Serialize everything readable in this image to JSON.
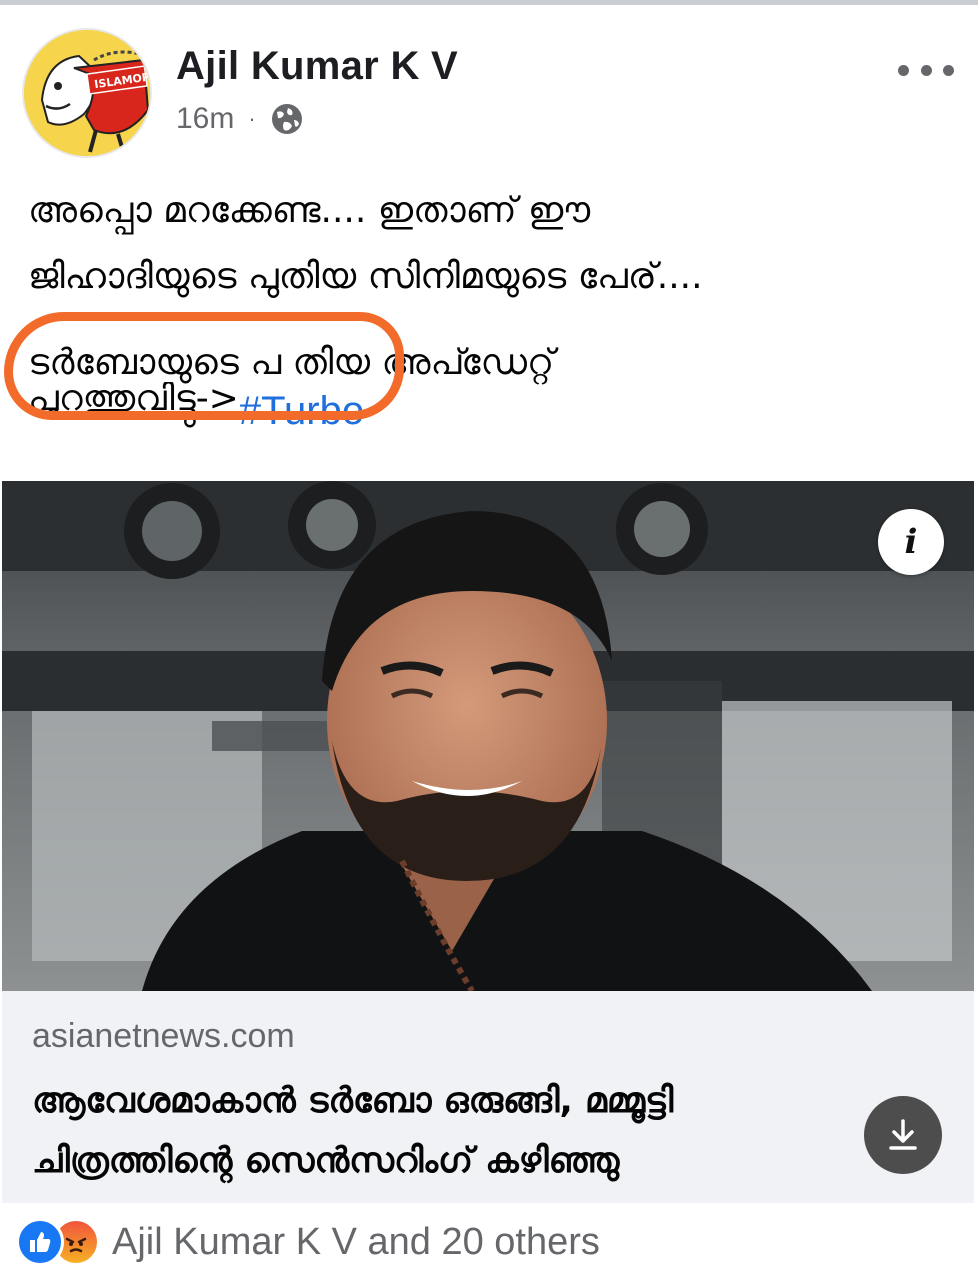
{
  "post": {
    "author": "Ajil Kumar K V",
    "avatar_text": "ISLAMOPH",
    "time": "16m",
    "separator": "·",
    "privacy_icon": "globe-icon",
    "more_icon": "more-options-icon",
    "text_lines": [
      "അപ്പൊ മറക്കേണ്ട.... ഇതാണ് ഈ",
      "ജിഹാദിയുടെ പുതിയ സിനിമയുടെ പേര്....",
      "ടർബോയുടെ പ തിയ അപ്ഡേറ്റ്",
      "പുറത്തുവിട്ടു->"
    ],
    "hashtag": "#Turbo",
    "highlight_color": "#f26b2a"
  },
  "link_preview": {
    "info_icon_label": "i",
    "domain": "asianetnews.com",
    "headline_lines": [
      "ആവേശമാകാൻ ടർബോ ഒരുങ്ങി, മമ്മൂട്ടി",
      "ചിത്രത്തിന്റെ സെൻസറിംഗ് കഴിഞ്ഞു"
    ],
    "download_icon": "download-icon"
  },
  "reactions": {
    "icons": [
      "like-icon",
      "angry-icon"
    ],
    "summary": "Ajil Kumar K V and 20 others",
    "like_color": "#1877f2"
  },
  "colors": {
    "link_blue": "#216fdb",
    "secondary_text": "#65676b",
    "card_background": "#f0f2f5"
  }
}
